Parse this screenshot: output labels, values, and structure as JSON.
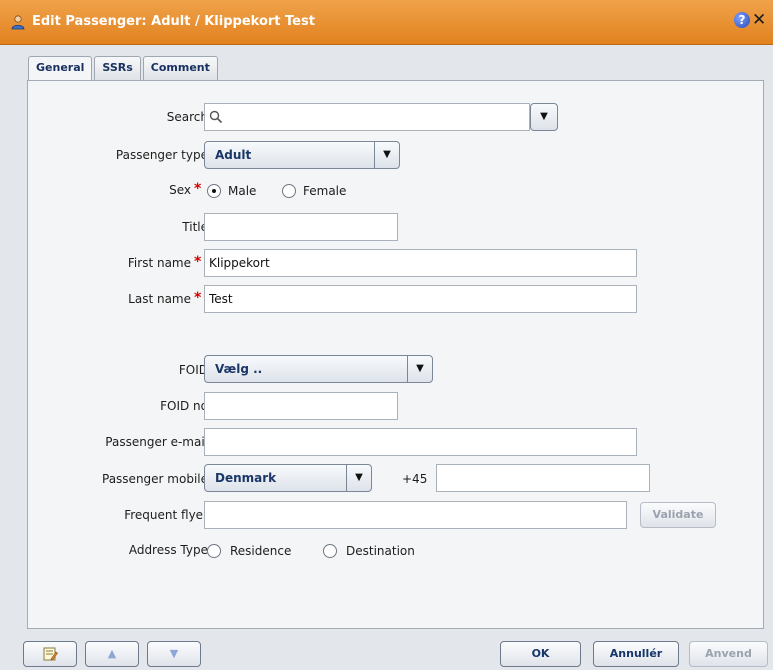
{
  "window": {
    "title": "Edit Passenger: Adult / Klippekort Test"
  },
  "tabs": [
    {
      "label": "General"
    },
    {
      "label": "SSRs"
    },
    {
      "label": "Comment"
    }
  ],
  "form": {
    "search_label": "Search",
    "search_value": "",
    "passenger_type_label": "Passenger type",
    "passenger_type_value": "Adult",
    "sex_label": "Sex",
    "sex_options": [
      "Male",
      "Female"
    ],
    "sex_selected": "Male",
    "title_label": "Title",
    "title_value": "",
    "first_name_label": "First name",
    "first_name_value": "Klippekort",
    "last_name_label": "Last name",
    "last_name_value": "Test",
    "foid_label": "FOID",
    "foid_value": "Vælg ..",
    "foid_no_label": "FOID no",
    "foid_no_value": "",
    "email_label": "Passenger e-mail",
    "email_value": "",
    "mobile_label": "Passenger mobile",
    "mobile_country": "Denmark",
    "mobile_prefix": "+45",
    "mobile_value": "",
    "ff_label": "Frequent flyer",
    "ff_value": "",
    "validate_label": "Validate",
    "address_label": "Address Type",
    "address_options": [
      "Residence",
      "Destination"
    ]
  },
  "buttons": {
    "ok": "OK",
    "cancel": "Annullér",
    "apply": "Anvend"
  },
  "required_marker": "*",
  "colors": {
    "titlebar": "#e58a25",
    "accent": "#16356a",
    "required": "#d40000"
  }
}
